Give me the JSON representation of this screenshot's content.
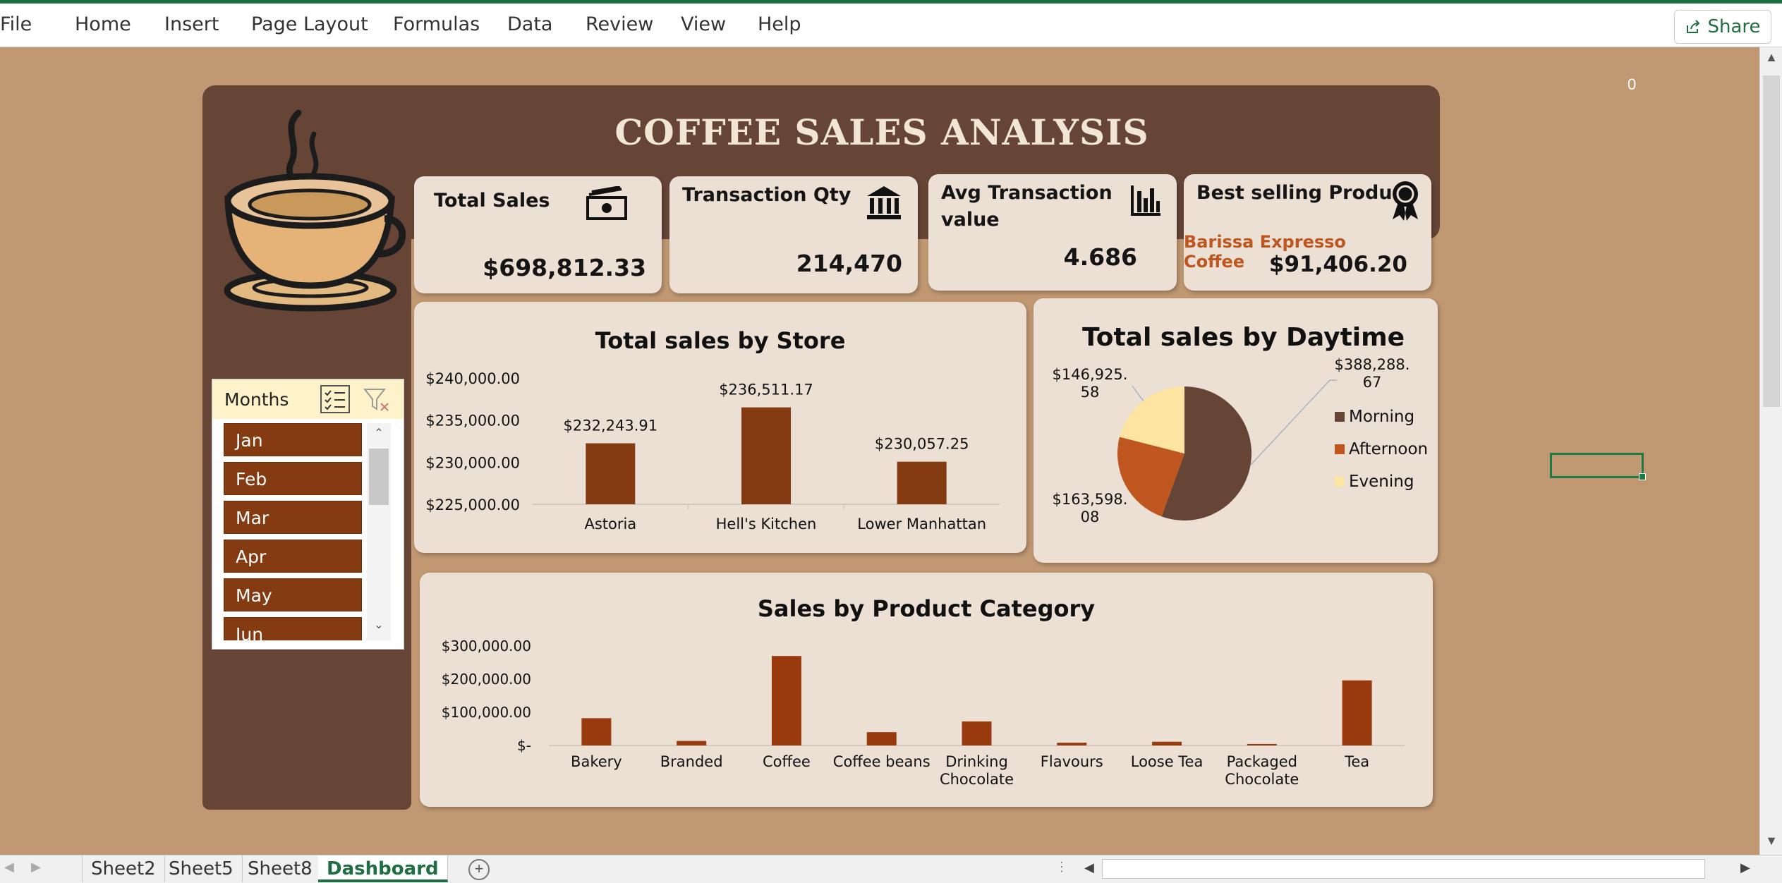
{
  "ribbon": {
    "menu": [
      "File",
      "Home",
      "Insert",
      "Page Layout",
      "Formulas",
      "Data",
      "Review",
      "View",
      "Help"
    ],
    "share_label": "Share"
  },
  "grid": {
    "cell_value": "0"
  },
  "dashboard": {
    "title": "COFFEE SALES ANALYSIS",
    "kpis": {
      "total_sales": {
        "label": "Total Sales",
        "value": "$698,812.33",
        "icon": "money-icon"
      },
      "transaction_qty": {
        "label": "Transaction Qty",
        "value": "214,470",
        "icon": "bank-icon"
      },
      "avg_transaction": {
        "label_line1": "Avg Transaction",
        "label_line2": "value",
        "value": "4.686",
        "icon": "bar-chart-icon"
      },
      "best_product": {
        "label": "Best selling Product",
        "product": "Barissa Expresso Coffee",
        "value": "$91,406.20",
        "icon": "award-ribbon-icon"
      }
    },
    "slicer": {
      "title": "Months",
      "items": [
        "Jan",
        "Feb",
        "Mar",
        "Apr",
        "May",
        "Jun"
      ]
    }
  },
  "chart_data": [
    {
      "type": "bar",
      "title": "Total sales by Store",
      "categories": [
        "Astoria",
        "Hell's Kitchen",
        "Lower Manhattan"
      ],
      "values": [
        232243.91,
        236511.17,
        230057.25
      ],
      "data_labels": [
        "$232,243.91",
        "$236,511.17",
        "$230,057.25"
      ],
      "ylim": [
        225000,
        240000
      ],
      "y_ticks": [
        "$240,000.00",
        "$235,000.00",
        "$230,000.00",
        "$225,000.00"
      ],
      "color": "#843b12"
    },
    {
      "type": "pie",
      "title": "Total sales by Daytime",
      "categories": [
        "Morning",
        "Afternoon",
        "Evening"
      ],
      "values": [
        388288.67,
        163598.08,
        146925.58
      ],
      "data_labels": [
        "$388,288.\n67",
        "$163,598.\n08",
        "$146,925.\n58"
      ],
      "colors": [
        "#664537",
        "#c0561f",
        "#fde4a0"
      ],
      "legend": "right"
    },
    {
      "type": "bar",
      "title": "Sales by Product Category",
      "categories": [
        "Bakery",
        "Branded",
        "Coffee",
        "Coffee beans",
        "Drinking\nChocolate",
        "Flavours",
        "Loose Tea",
        "Packaged\nChocolate",
        "Tea"
      ],
      "values": [
        82300,
        13600,
        269900,
        40100,
        72500,
        8400,
        11200,
        4400,
        196400
      ],
      "ylim": [
        0,
        300000
      ],
      "y_ticks": [
        "$300,000.00",
        "$200,000.00",
        "$100,000.00",
        "$-"
      ],
      "color": "#993a0e"
    }
  ],
  "sheets": {
    "tabs": [
      "Sheet2",
      "Sheet5",
      "Sheet8",
      "Dashboard"
    ],
    "active": "Dashboard"
  }
}
